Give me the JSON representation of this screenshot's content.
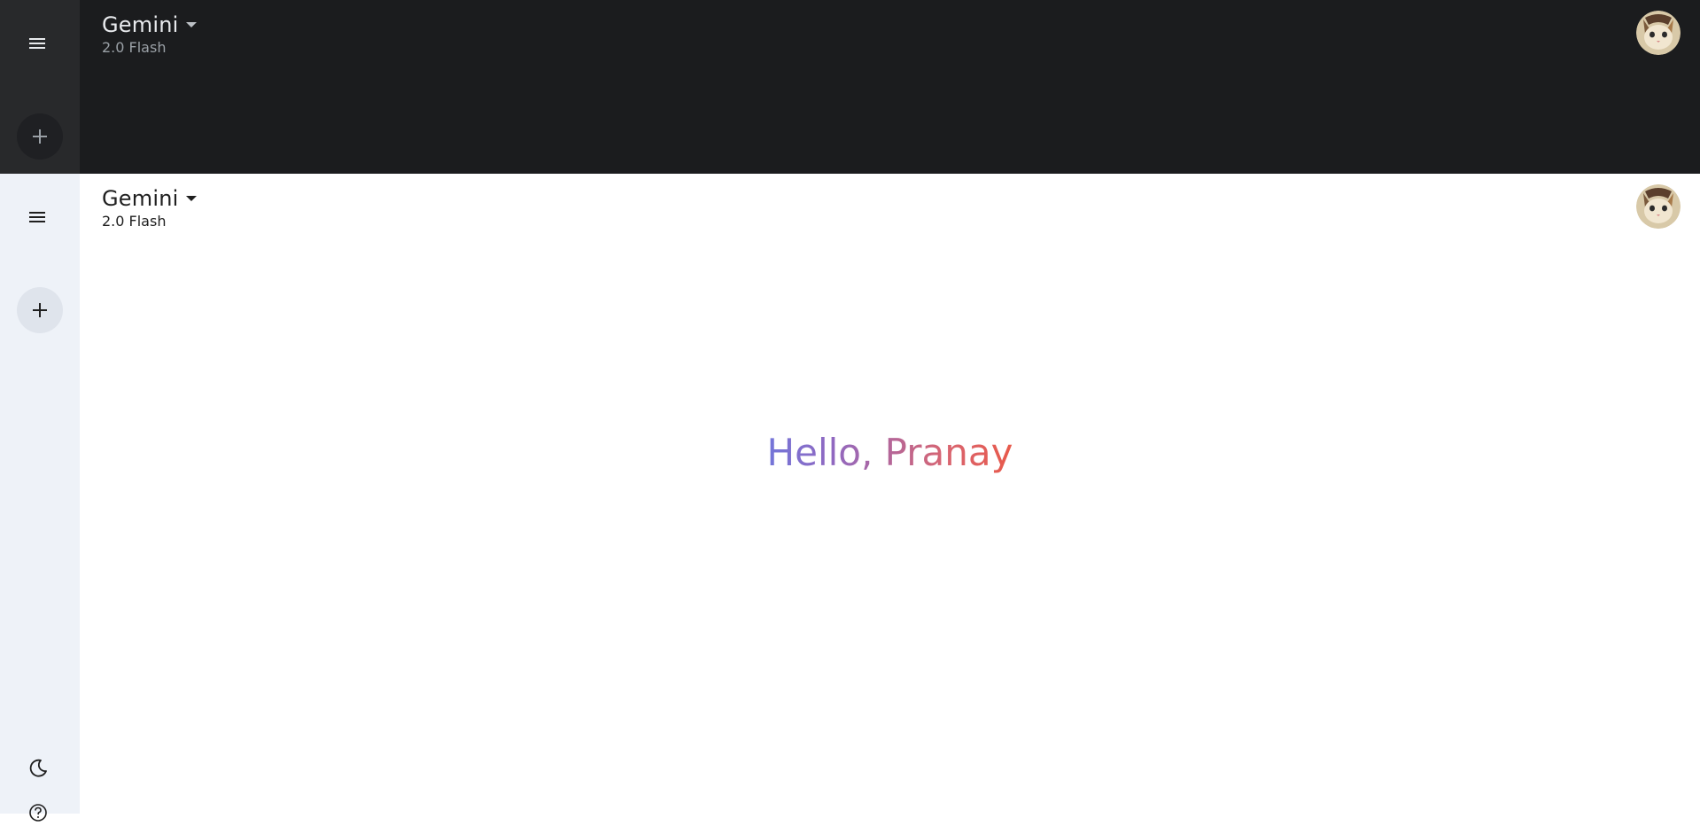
{
  "dark_view": {
    "header": {
      "title": "Gemini",
      "model": "2.0 Flash"
    }
  },
  "light_view": {
    "header": {
      "title": "Gemini",
      "model": "2.0 Flash"
    },
    "greeting": "Hello, Pranay"
  },
  "icons": {
    "menu": "hamburger-menu-icon",
    "new_chat": "plus-icon",
    "theme": "moon-icon",
    "help": "help-circle-icon",
    "model_picker": "caret-down-icon"
  },
  "colors": {
    "dark_bg": "#1b1c1e",
    "dark_sidebar": "#28292b",
    "light_sidebar": "#eef2f8",
    "greeting_gradient": [
      "#4f86f7",
      "#9168c0",
      "#d96570",
      "#e8594a"
    ]
  }
}
